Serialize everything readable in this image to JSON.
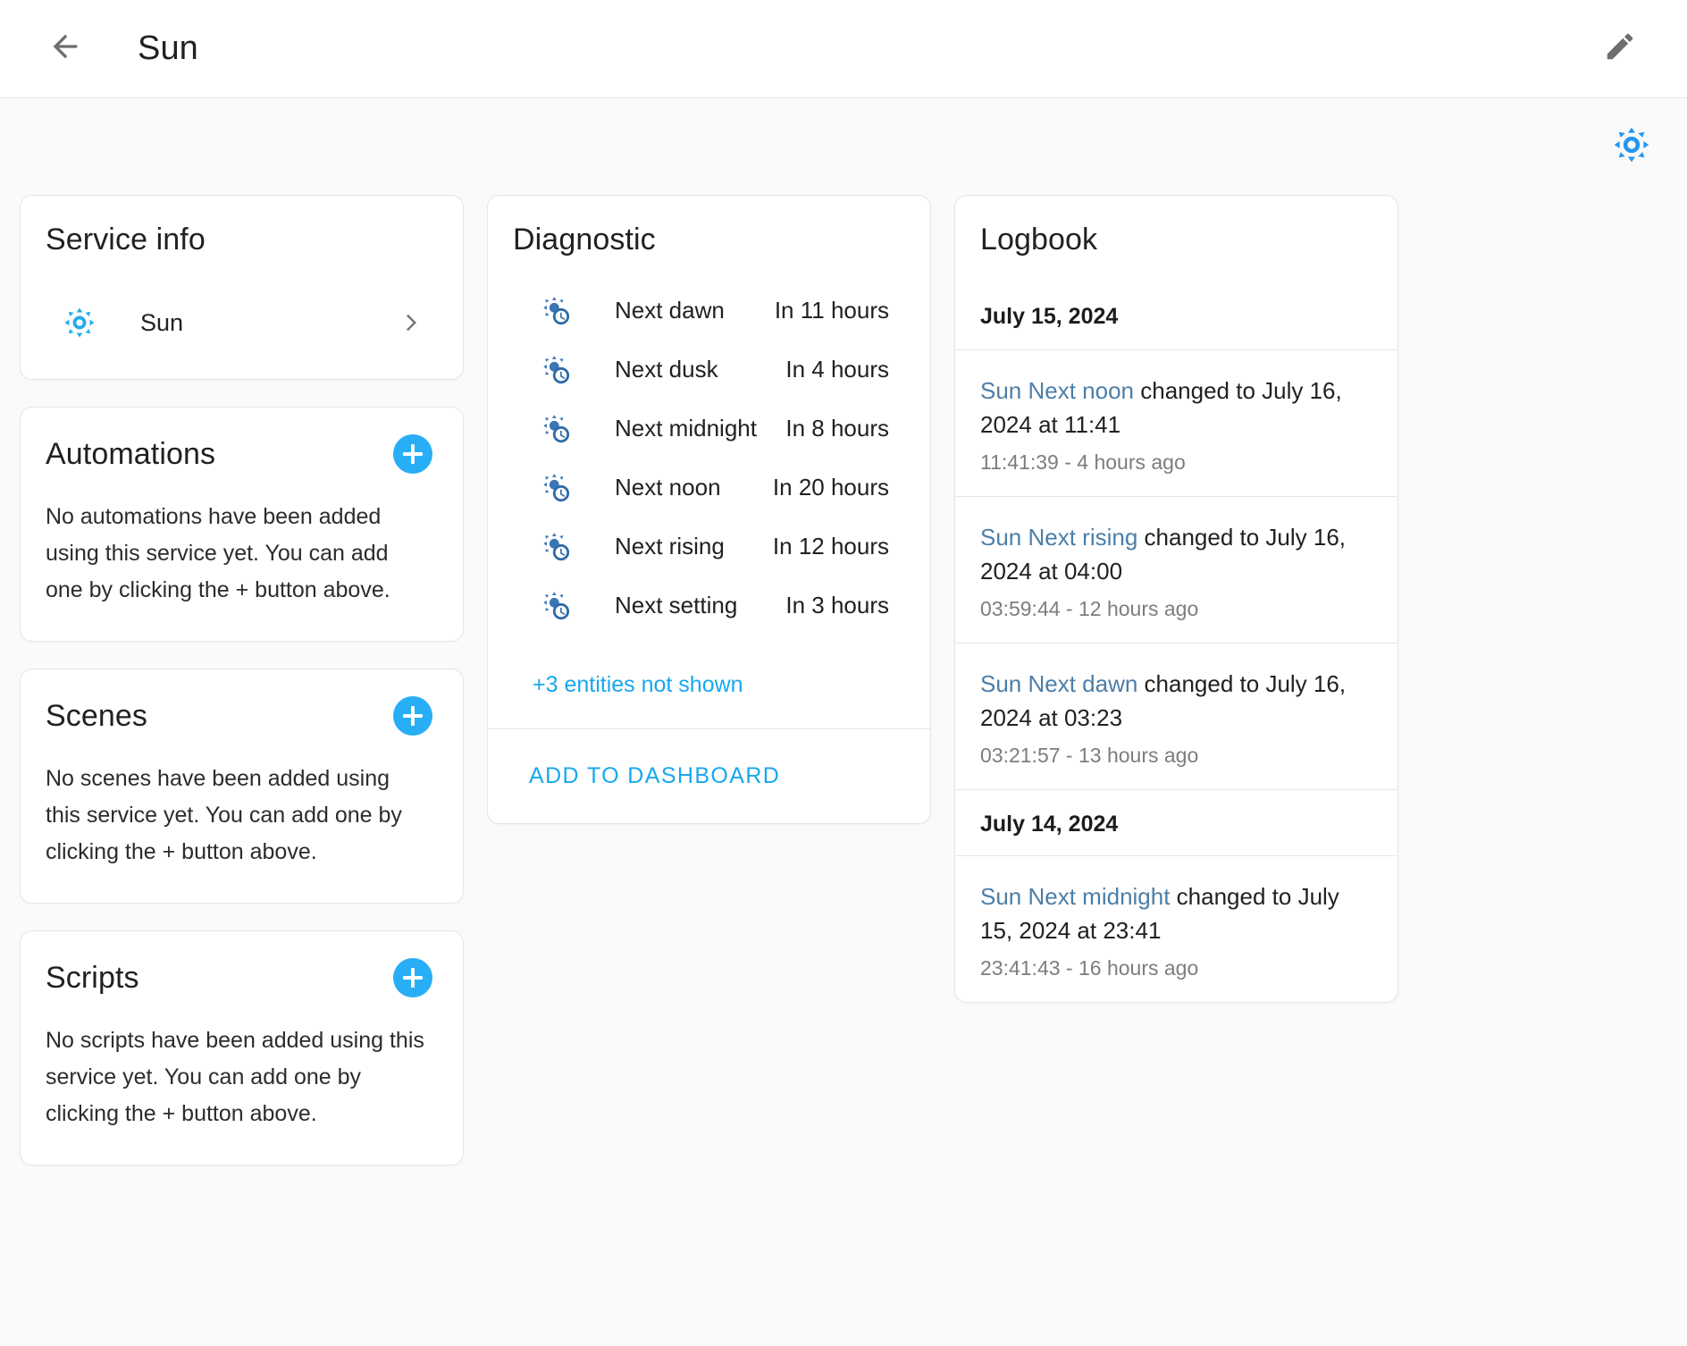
{
  "appbar": {
    "back_icon": "arrow-left-icon",
    "title": "Sun",
    "edit_icon": "pencil-icon"
  },
  "integration": {
    "icon": "sun-icon",
    "accent": "#2196f3"
  },
  "colors": {
    "accent_blue": "#28aef4",
    "link_blue": "#16a7ef",
    "logbook_link": "#4c7ea8",
    "diagnostic_icon": "#3a76b4"
  },
  "service_info": {
    "title": "Service info",
    "entry": {
      "icon": "sun-icon",
      "label": "Sun",
      "chevron": "chevron-right-icon"
    }
  },
  "automations": {
    "title": "Automations",
    "add_icon": "plus-icon",
    "empty_text": "No automations have been added using this service yet. You can add one by clicking the + button above."
  },
  "scenes": {
    "title": "Scenes",
    "add_icon": "plus-icon",
    "empty_text": "No scenes have been added using this service yet. You can add one by clicking the + button above."
  },
  "scripts": {
    "title": "Scripts",
    "add_icon": "plus-icon",
    "empty_text": "No scripts have been added using this service yet. You can add one by clicking the + button above."
  },
  "diagnostic": {
    "title": "Diagnostic",
    "entities": [
      {
        "icon": "sun-clock-icon",
        "label": "Next dawn",
        "value": "In 11 hours"
      },
      {
        "icon": "sun-clock-icon",
        "label": "Next dusk",
        "value": "In 4 hours"
      },
      {
        "icon": "sun-clock-icon",
        "label": "Next midnight",
        "value": "In 8 hours"
      },
      {
        "icon": "sun-clock-icon",
        "label": "Next noon",
        "value": "In 20 hours"
      },
      {
        "icon": "sun-clock-icon",
        "label": "Next rising",
        "value": "In 12 hours"
      },
      {
        "icon": "sun-clock-icon",
        "label": "Next setting",
        "value": "In 3 hours"
      }
    ],
    "more_link": "+3 entities not shown",
    "action_label": "ADD TO DASHBOARD"
  },
  "logbook": {
    "title": "Logbook",
    "groups": [
      {
        "date": "July 15, 2024",
        "entries": [
          {
            "entity": "Sun Next noon",
            "text": " changed to July 16, 2024 at 11:41",
            "meta": "11:41:39 - 4 hours ago"
          },
          {
            "entity": "Sun Next rising",
            "text": " changed to July 16, 2024 at 04:00",
            "meta": "03:59:44 - 12 hours ago"
          },
          {
            "entity": "Sun Next dawn",
            "text": " changed to July 16, 2024 at 03:23",
            "meta": "03:21:57 - 13 hours ago"
          }
        ]
      },
      {
        "date": "July 14, 2024",
        "entries": [
          {
            "entity": "Sun Next midnight",
            "text": " changed to July 15, 2024 at 23:41",
            "meta": "23:41:43 - 16 hours ago"
          }
        ]
      }
    ]
  }
}
